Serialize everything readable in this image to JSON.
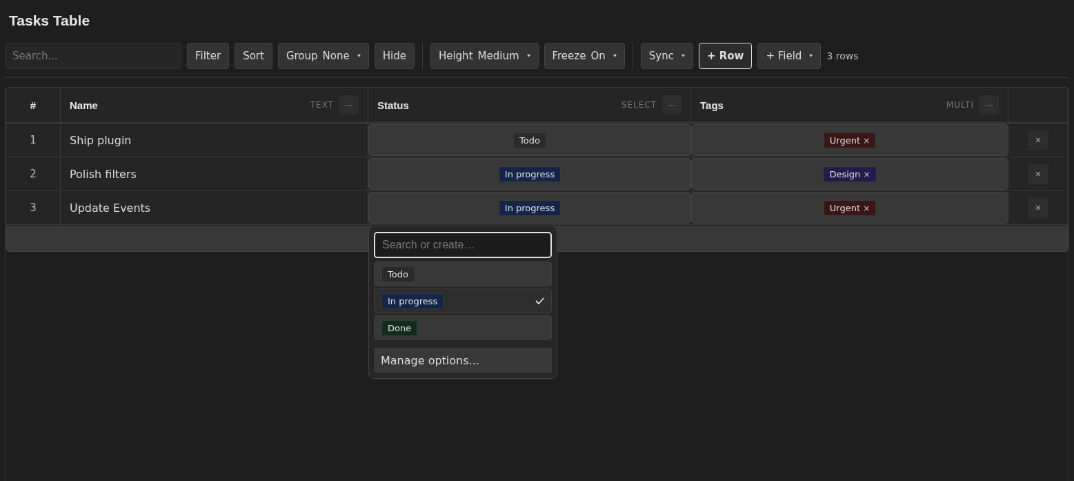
{
  "title": "Tasks Table",
  "search": {
    "placeholder": "Search..."
  },
  "toolbar_groups": [
    [
      {
        "label": "Filter",
        "caret": false,
        "primary": false
      },
      {
        "label": "Sort",
        "caret": false,
        "primary": false
      },
      {
        "label": "Group",
        "value": "None",
        "caret": true,
        "primary": false
      },
      {
        "label": "Hide",
        "caret": false,
        "primary": false
      }
    ],
    [
      {
        "label": "Height",
        "value": "Medium",
        "caret": true,
        "primary": false
      },
      {
        "label": "Freeze",
        "value": "On",
        "caret": true,
        "primary": false
      }
    ],
    [
      {
        "label": "Sync",
        "caret": true,
        "primary": false
      },
      {
        "label": "+ Row",
        "caret": false,
        "primary": true
      },
      {
        "label": "+ Field",
        "caret": true,
        "primary": false
      }
    ]
  ],
  "row_count": "3 rows",
  "table": {
    "columns": [
      {
        "name": "#",
        "kind": "index"
      },
      {
        "name": "Name",
        "type": "TEXT",
        "menu": "···",
        "kind": "text"
      },
      {
        "name": "Status",
        "type": "SELECT",
        "menu": "···",
        "kind": "select"
      },
      {
        "name": "Tags",
        "type": "MULTI",
        "menu": "···",
        "kind": "multi"
      },
      {
        "kind": "actions"
      }
    ],
    "rows": [
      {
        "index": "1",
        "name": "Ship plugin",
        "status": {
          "label": "Todo",
          "color": "#2a2a2a"
        },
        "tags": [
          {
            "label": "Urgent",
            "remove": "×",
            "color": "#3b1616"
          }
        ],
        "delete": "×"
      },
      {
        "index": "2",
        "name": "Polish filters",
        "status": {
          "label": "In progress",
          "color": "#13264a"
        },
        "tags": [
          {
            "label": "Design",
            "remove": "×",
            "color": "#231b4a"
          }
        ],
        "delete": "×"
      },
      {
        "index": "3",
        "name": "Update Events",
        "status": {
          "label": "In progress",
          "color": "#13264a"
        },
        "tags": [
          {
            "label": "Urgent",
            "remove": "×",
            "color": "#3b1616"
          }
        ],
        "delete": "×"
      }
    ]
  },
  "dropdown": {
    "search": {
      "placeholder": "Search or create…",
      "focused": true
    },
    "options": [
      {
        "label": "Todo",
        "color": "#2a2a2a",
        "selected": false
      },
      {
        "label": "In progress",
        "color": "#13264a",
        "selected": true
      },
      {
        "label": "Done",
        "color": "#122e1b",
        "selected": false
      }
    ],
    "manage": "Manage options..."
  }
}
